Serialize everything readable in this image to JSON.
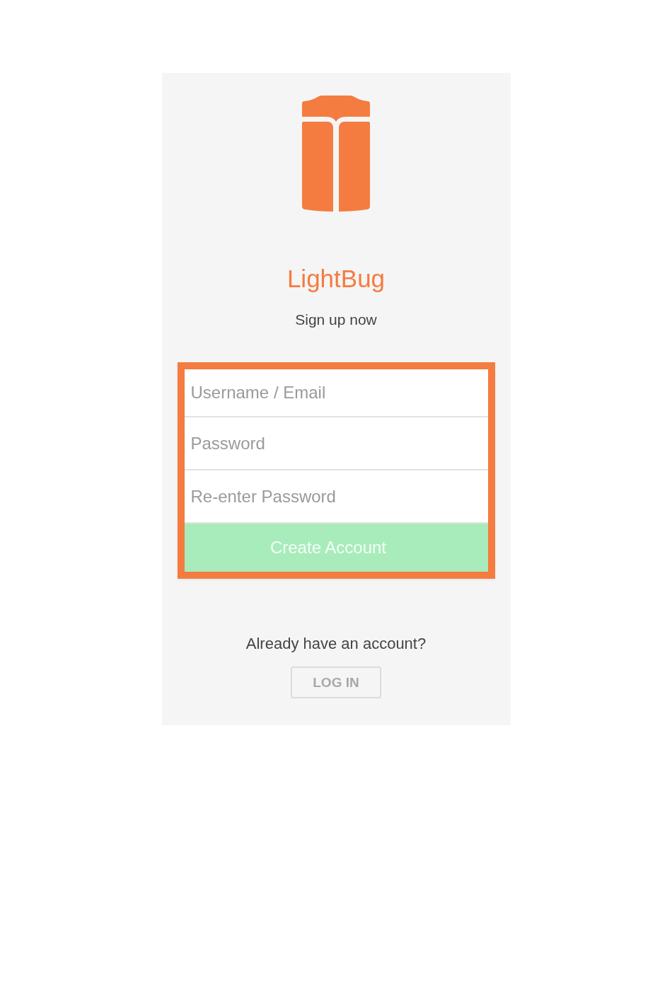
{
  "header": {
    "title": "LightBug",
    "subtitle": "Sign up now"
  },
  "form": {
    "fields": [
      {
        "placeholder": "Username / Email"
      },
      {
        "placeholder": "Password"
      },
      {
        "placeholder": "Re-enter Password"
      }
    ],
    "submit": "Create Account"
  },
  "login": {
    "prompt": "Already have an account?",
    "button": "LOG IN"
  }
}
